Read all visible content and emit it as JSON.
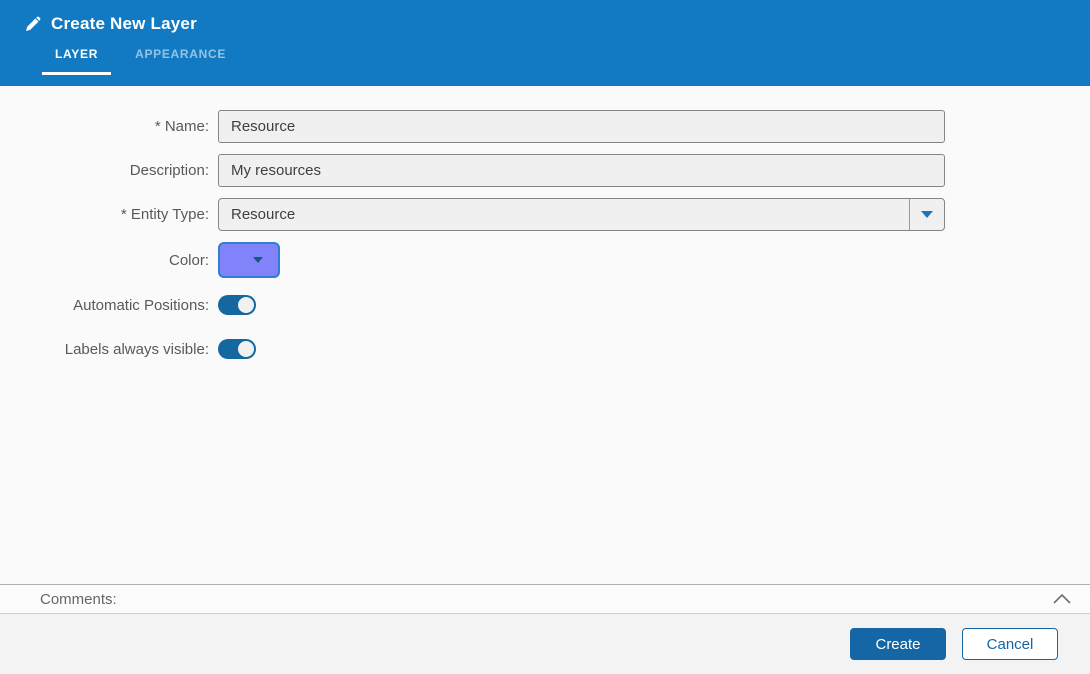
{
  "colors": {
    "header_blue": "#127ac2",
    "accent_blue": "#1466a5",
    "toggle_on": "#1567a0",
    "swatch_fill": "#8282fa",
    "swatch_border": "#2e7fd0",
    "input_bg": "#f0f0f0"
  },
  "header": {
    "icon": "pencil-icon",
    "title": "Create New Layer",
    "tabs": [
      {
        "label": "LAYER",
        "active": true
      },
      {
        "label": "APPEARANCE",
        "active": false
      }
    ]
  },
  "form": {
    "name": {
      "label": "* Name:",
      "value": "Resource",
      "required": true
    },
    "description": {
      "label": "Description:",
      "value": "My resources",
      "required": false
    },
    "entity_type": {
      "label": "* Entity Type:",
      "value": "Resource",
      "required": true,
      "icon": "chevron-down-icon"
    },
    "color": {
      "label": "Color:",
      "value": "#8282fa",
      "icon": "chevron-down-icon"
    },
    "automatic_positions": {
      "label": "Automatic Positions:",
      "value": true
    },
    "labels_always_visible": {
      "label": "Labels always visible:",
      "value": true
    }
  },
  "comments": {
    "label": "Comments:",
    "collapse_icon": "chevron-up-icon",
    "expanded": false
  },
  "footer": {
    "create_label": "Create",
    "cancel_label": "Cancel"
  }
}
